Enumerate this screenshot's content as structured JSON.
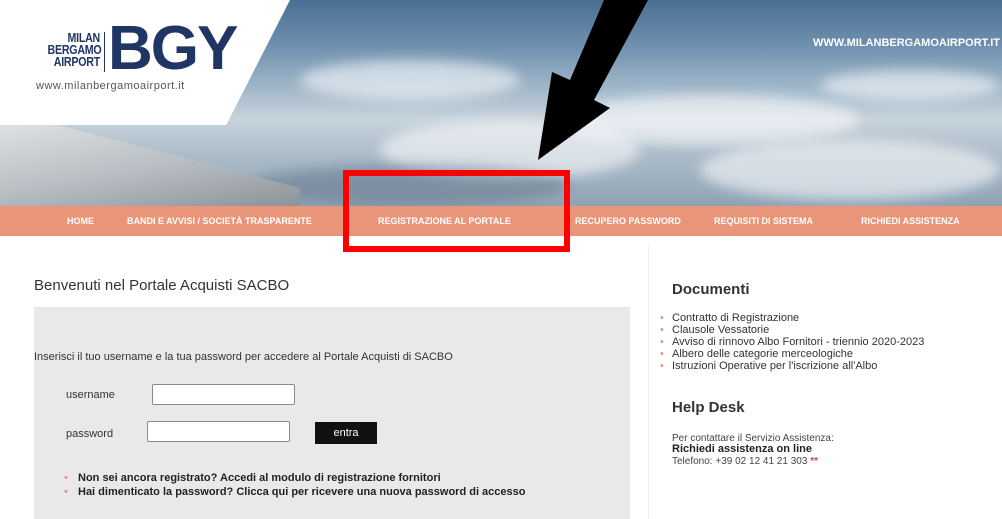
{
  "header": {
    "logo_small_lines": [
      "MILAN",
      "BERGAMO",
      "AIRPORT"
    ],
    "logo_big": "BGY",
    "logo_url": "www.milanbergamoairport.it",
    "site_url": "WWW.MILANBERGAMOAIRPORT.IT"
  },
  "nav": {
    "items": [
      {
        "label": "Home"
      },
      {
        "label": "Bandi e Avvisi / Società Trasparente"
      },
      {
        "label": "Registrazione al Portale"
      },
      {
        "label": "Recupero Password"
      },
      {
        "label": "Requisiti di Sistema"
      },
      {
        "label": "Richiedi Assistenza"
      }
    ]
  },
  "main": {
    "welcome": "Benvenuti nel Portale Acquisti SACBO",
    "intro": "Inserisci il tuo username e la tua password per accedere al Portale Acquisti di SACBO",
    "username_label": "username",
    "password_label": "password",
    "username_value": "",
    "password_value": "",
    "submit_label": "entra",
    "links": [
      "Non sei ancora registrato? Accedi al modulo di registrazione fornitori",
      "Hai dimenticato la password? Clicca qui per ricevere una nuova password di accesso"
    ]
  },
  "sidebar": {
    "documents_title": "Documenti",
    "documents": [
      "Contratto di Registrazione",
      "Clausole Vessatorie",
      "Avviso di rinnovo Albo Fornitori - triennio 2020-2023",
      "Albero delle categorie merceologiche",
      "Istruzioni Operative per l'iscrizione all'Albo"
    ],
    "helpdesk_title": "Help Desk",
    "help_line1": "Per contattare il Servizio Assistenza:",
    "help_link": "Richiedi assistenza on line",
    "help_phone": "Telefono: +39 02 12 41 21 303",
    "help_star": "**"
  },
  "colors": {
    "nav_bg": "#e8957a",
    "logo_blue": "#1f3564",
    "annotation_red": "#ff0000"
  }
}
